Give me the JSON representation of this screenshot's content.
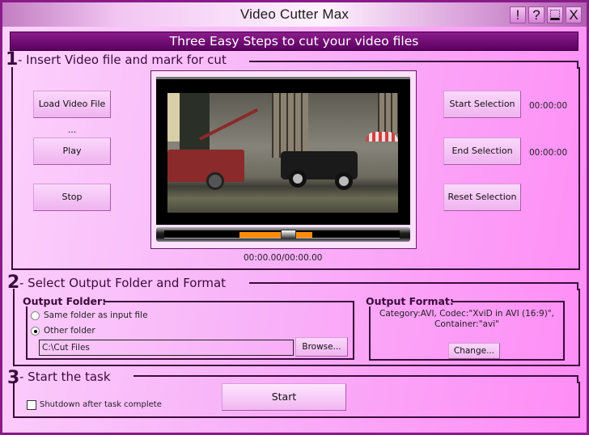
{
  "window": {
    "title": "Video Cutter Max",
    "controls": [
      {
        "name": "about-button",
        "icon": "exclamation-icon",
        "glyph": "!"
      },
      {
        "name": "help-button",
        "icon": "help-icon",
        "glyph": "?"
      },
      {
        "name": "minimize-button",
        "icon": "minimize-icon",
        "glyph": "_"
      },
      {
        "name": "close-button",
        "icon": "close-icon",
        "glyph": "X"
      }
    ]
  },
  "banner": "Three Easy Steps to cut your video files",
  "step1": {
    "number": "1",
    "title": "- Insert Video file and mark for cut",
    "buttons": {
      "load": "Load Video File ...",
      "play": "Play",
      "stop": "Stop",
      "start_selection": "Start Selection",
      "end_selection": "End Selection",
      "reset_selection": "Reset Selection"
    },
    "start_time": "00:00:00",
    "end_time": "00:00:00",
    "playback_time": "00:00.00/00:00.00",
    "seekbar": {
      "selection_start_percent": 32,
      "selection_end_percent": 63,
      "thumb_percent": 53,
      "selection_color": "#ff8c00"
    }
  },
  "step2": {
    "number": "2",
    "title": "- Select Output Folder and Format",
    "output_folder": {
      "label": "Output Folder:",
      "option_same": "Same folder as input file",
      "option_other": "Other folder",
      "selected": "other",
      "path": "C:\\Cut Files",
      "browse_label": "Browse..."
    },
    "output_format": {
      "label": "Output Format:",
      "line1": "Category:AVI, Codec:\"XviD in AVI (16:9)\",",
      "line2": "Container:\"avi\"",
      "change_label": "Change..."
    }
  },
  "step3": {
    "number": "3",
    "title": "- Start the task",
    "shutdown_label": "Shutdown after task complete",
    "shutdown_checked": false,
    "start_label": "Start"
  },
  "colors": {
    "accent": "#8c1c8c",
    "border": "#3b0b3b",
    "background": "#f8b4f8"
  }
}
